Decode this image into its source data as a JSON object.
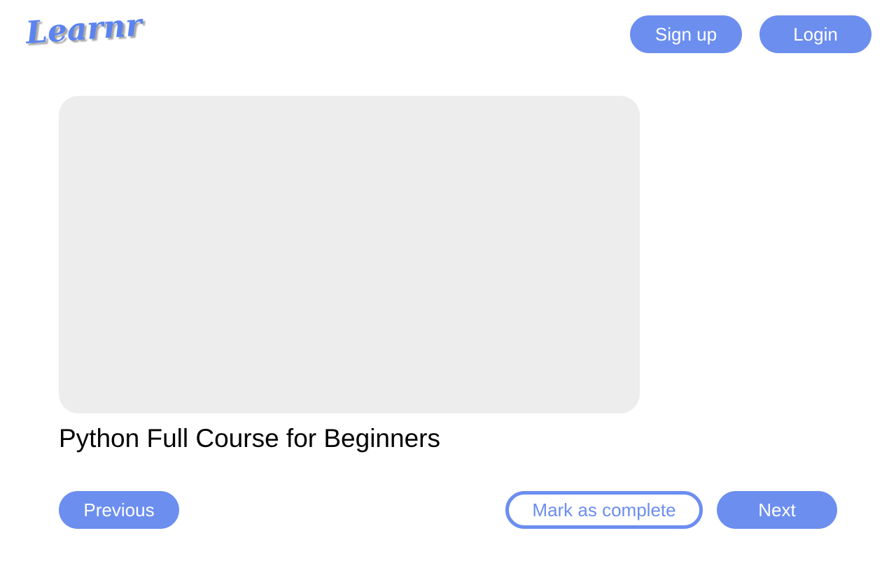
{
  "header": {
    "logo_text": "Learnr",
    "signup_label": "Sign up",
    "login_label": "Login"
  },
  "main": {
    "course_title": "Python Full Course for Beginners"
  },
  "controls": {
    "previous_label": "Previous",
    "mark_complete_label": "Mark as complete",
    "next_label": "Next"
  },
  "colors": {
    "accent": "#6c8eef",
    "video_placeholder": "#ededed",
    "text": "#000000",
    "background": "#ffffff"
  }
}
